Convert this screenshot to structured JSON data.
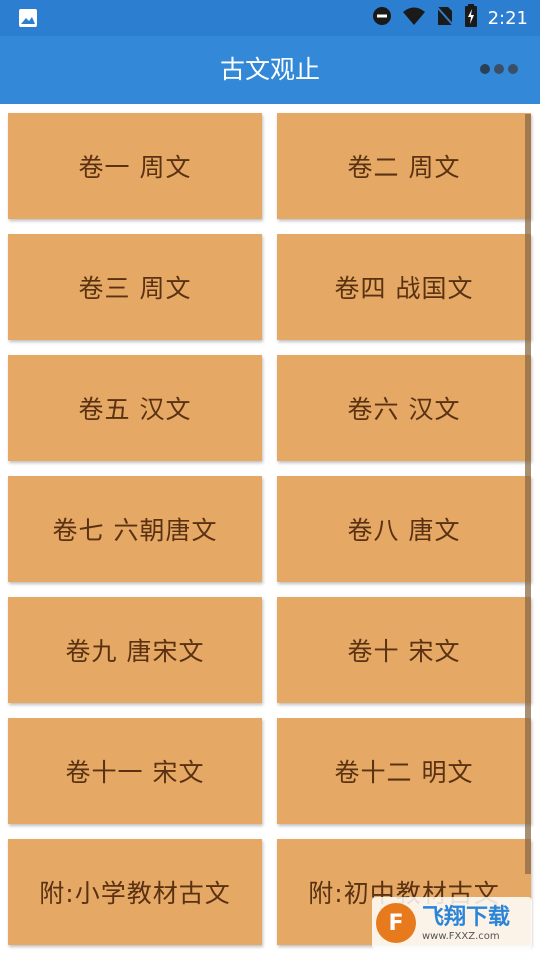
{
  "status_bar": {
    "time": "2:21",
    "icons": [
      "image-icon",
      "dnd-icon",
      "wifi-icon",
      "no-sim-icon",
      "battery-charging-icon"
    ]
  },
  "app_bar": {
    "title": "古文观止",
    "menu_icon": "more-dots-icon"
  },
  "volumes": [
    {
      "label": "卷一  周文"
    },
    {
      "label": "卷二  周文"
    },
    {
      "label": "卷三  周文"
    },
    {
      "label": "卷四  战国文"
    },
    {
      "label": "卷五  汉文"
    },
    {
      "label": "卷六  汉文"
    },
    {
      "label": "卷七  六朝唐文"
    },
    {
      "label": "卷八  唐文"
    },
    {
      "label": "卷九  唐宋文"
    },
    {
      "label": "卷十  宋文"
    },
    {
      "label": "卷十一 宋文"
    },
    {
      "label": "卷十二 明文"
    },
    {
      "label": "附:小学教材古文"
    },
    {
      "label": "附:初中教材古文"
    }
  ],
  "watermark": {
    "brand": "飞翔下载",
    "url": "www.FXXZ.com"
  },
  "colors": {
    "status_bar": "#2c7fd0",
    "app_bar": "#3388d8",
    "card": "#e5a865",
    "card_text": "#5a3212"
  }
}
